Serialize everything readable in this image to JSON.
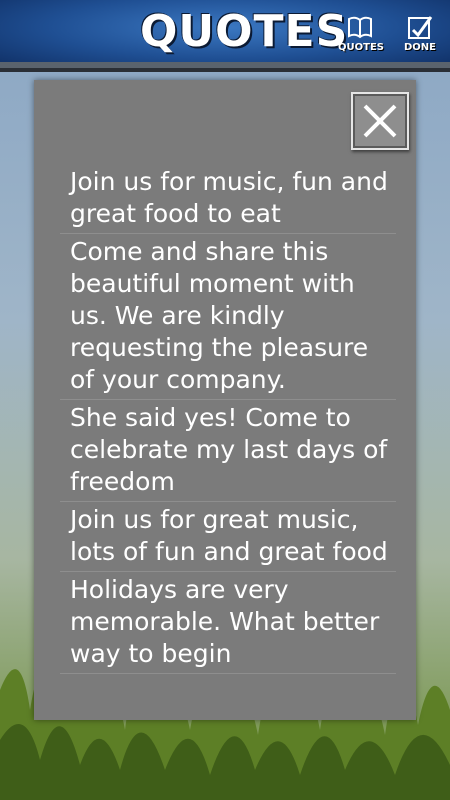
{
  "header": {
    "title": "QUOTES",
    "quotes_label": "QUOTES",
    "done_label": "DONE"
  },
  "dialog": {
    "close_icon": "close-icon",
    "quotes": [
      "Join us for music, fun and great food to eat",
      "Come and share this beautiful moment with us. We are kindly requesting the pleasure of your company.",
      "She said yes! Come to celebrate my last days of freedom",
      "Join us for great music, lots of fun and great food",
      "Holidays are very memorable. What better way to begin"
    ]
  },
  "colors": {
    "header_blue": "#1f4f93",
    "dialog_bg": "#7b7b7b",
    "text": "#ffffff"
  }
}
